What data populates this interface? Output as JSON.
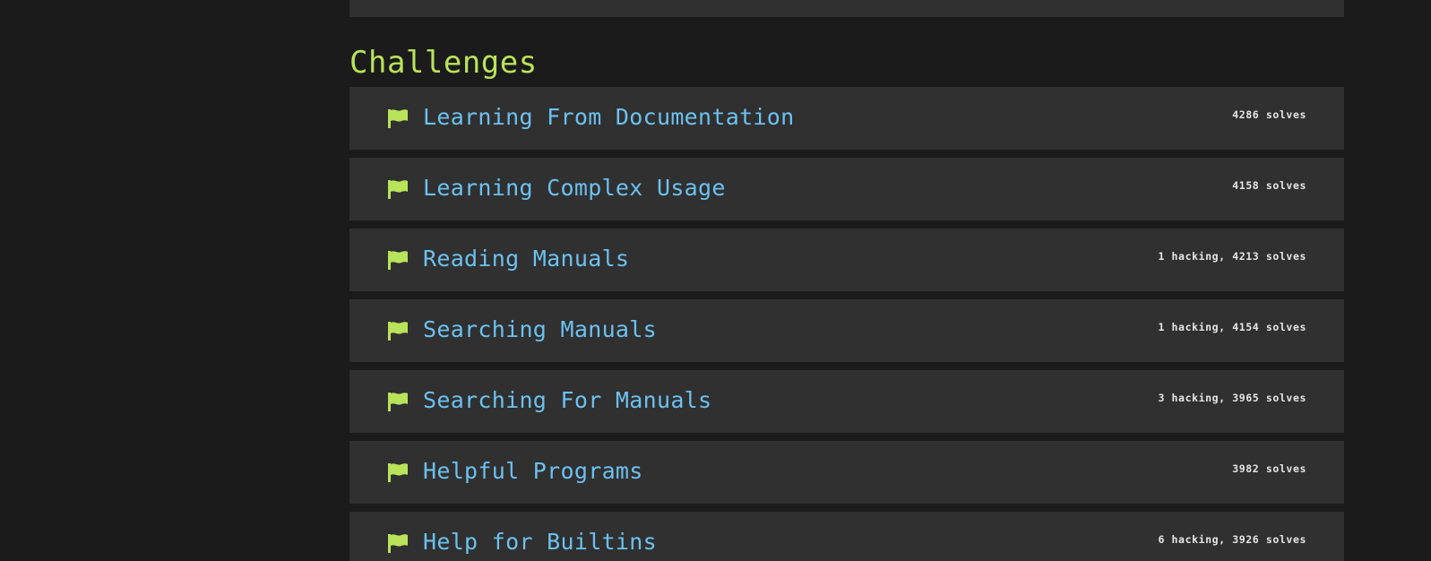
{
  "section": {
    "title": "Challenges"
  },
  "colors": {
    "background": "#1b1b1b",
    "card": "#303030",
    "accent_green": "#b9e35a",
    "link_blue": "#6cc1f0",
    "stats_text": "#e6e6e6"
  },
  "challenges": [
    {
      "icon": "flag-icon",
      "name": "Learning From Documentation",
      "stats": "4286 solves"
    },
    {
      "icon": "flag-icon",
      "name": "Learning Complex Usage",
      "stats": "4158 solves"
    },
    {
      "icon": "flag-icon",
      "name": "Reading Manuals",
      "stats": "1 hacking, 4213 solves"
    },
    {
      "icon": "flag-icon",
      "name": "Searching Manuals",
      "stats": "1 hacking, 4154 solves"
    },
    {
      "icon": "flag-icon",
      "name": "Searching For Manuals",
      "stats": "3 hacking, 3965 solves"
    },
    {
      "icon": "flag-icon",
      "name": "Helpful Programs",
      "stats": "3982 solves"
    },
    {
      "icon": "flag-icon",
      "name": "Help for Builtins",
      "stats": "6 hacking, 3926 solves"
    }
  ]
}
